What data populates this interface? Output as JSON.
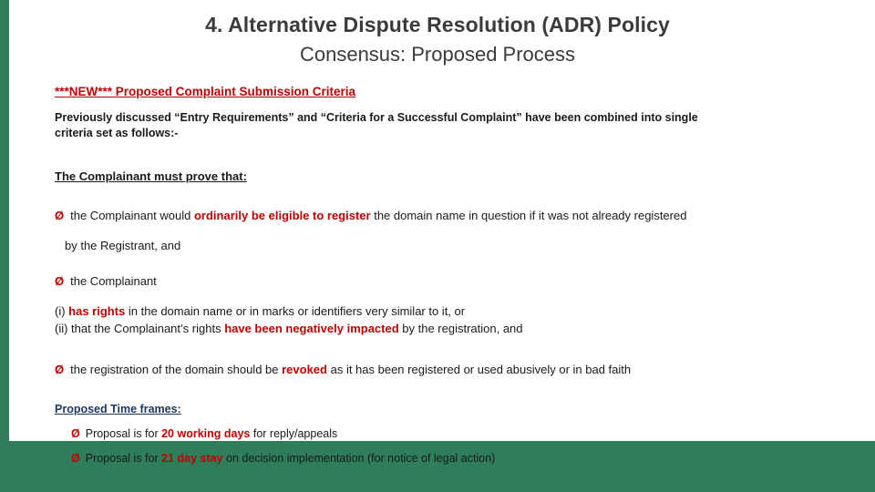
{
  "slide": {
    "title_line1": "4. Alternative Dispute Resolution (ADR) Policy",
    "title_line2": "Consensus: Proposed Process",
    "new_criteria_heading": "***NEW*** Proposed Complaint Submission Criteria",
    "intro_paragraph_line1": "Previously discussed “Entry Requirements” and “Criteria for a Successful Complaint” have been combined into single",
    "intro_paragraph_line2": "criteria set as follows:-",
    "must_prove_heading": "The Complainant must prove that:",
    "bullet_glyph": "Ø",
    "bullets": [
      {
        "pre": "the Complainant would ",
        "emphasis": "ordinarily be eligible to register",
        "post": " the domain name in question if it was not already registered"
      },
      {
        "pre": "the Complainant",
        "emphasis": "",
        "post": ""
      }
    ],
    "continuation_line": "by the Registrant, and",
    "clause_i_pre": "(i) ",
    "clause_i_emphasis": "has rights",
    "clause_i_post": " in the domain name or in marks or identifiers very similar to it, or",
    "clause_ii_pre": "(ii) that the Complainant’s rights ",
    "clause_ii_emphasis": "have been negatively impacted",
    "clause_ii_post": " by the registration, and",
    "revoked_bullet_pre": "the registration of the domain should be ",
    "revoked_bullet_emphasis": "revoked",
    "revoked_bullet_post": " as it has been registered or used abusively or in bad faith",
    "timeframes_heading": "Proposed Time frames:",
    "timeframes": [
      {
        "pre": "Proposal is for ",
        "emphasis": "20 working days",
        "post": " for reply/appeals"
      },
      {
        "pre": "Proposal is for ",
        "emphasis": "21 day stay",
        "post": " on decision implementation (for notice of legal action)"
      }
    ],
    "colors": {
      "accent_green": "#2e7d5b",
      "emphasis_red": "#c00000",
      "heading_navy": "#1f3864",
      "title_gray": "#3b3b3b"
    }
  }
}
